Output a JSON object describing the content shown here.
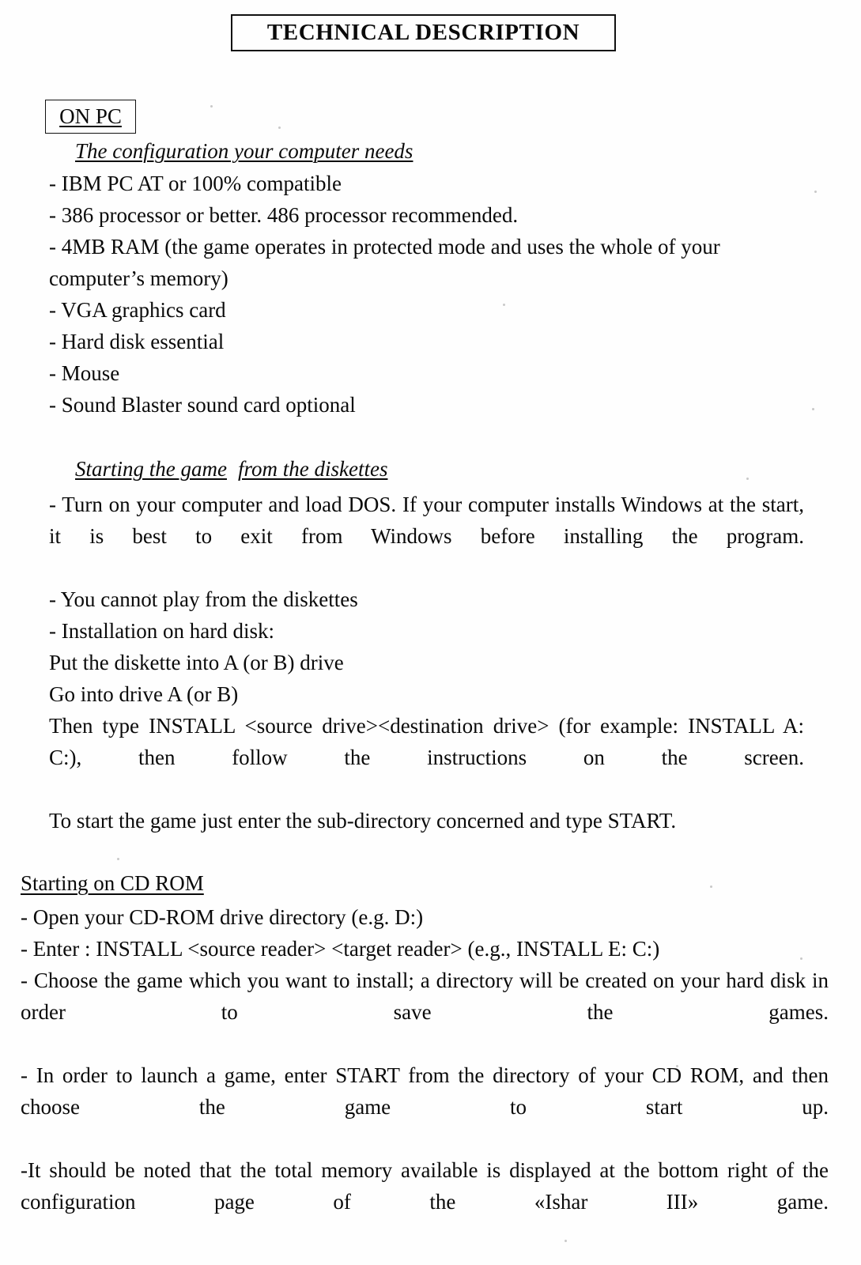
{
  "document": {
    "title": "TECHNICAL DESCRIPTION"
  },
  "sections": {
    "on_pc": {
      "heading": "ON PC",
      "subheading_config": "The configuration your computer needs",
      "requirements": [
        "- IBM PC AT or 100% compatible",
        "- 386 processor or better. 486 processor recommended.",
        "- 4MB RAM (the game operates in protected mode and uses the whole of your computer’s memory)",
        "- VGA graphics card",
        "- Hard disk essential",
        "- Mouse",
        "- Sound Blaster sound card optional"
      ],
      "subheading_diskettes_part1": "Starting the game",
      "subheading_diskettes_part2": "from the diskettes",
      "diskette_lines": [
        "- Turn on your computer and load DOS. If your computer installs Windows at the start, it is best to exit from Windows before installing the program.",
        "- You cannot play from the diskettes",
        "- Installation on hard disk:",
        "Put the diskette into A (or B) drive",
        "Go into drive A (or B)",
        "Then type INSTALL <source drive><destination drive> (for example: INSTALL A: C:), then follow the instructions on the screen.",
        "To start the game just enter the sub-directory concerned and type START."
      ]
    },
    "cd_rom": {
      "heading": "Starting on CD ROM",
      "lines": [
        "- Open your CD-ROM drive directory (e.g. D:)",
        "- Enter : INSTALL <source reader> <target reader> (e.g., INSTALL E: C:)",
        "- Choose the game which you want to install; a directory will be created on your hard disk in order to save the games.",
        "- In order to launch a game, enter START from the directory of your CD ROM, and then choose the game to start up.",
        "-It should be noted that the total memory available is displayed at the bottom right of the configuration page of the «Ishar III» game."
      ]
    }
  },
  "colors": {
    "page_background": "#fefefe",
    "ink": "#0a0a0a",
    "rule": "#111111"
  }
}
